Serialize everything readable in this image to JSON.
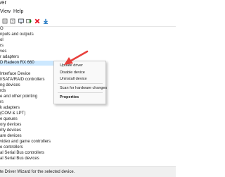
{
  "window": {
    "title_fragment": "ver"
  },
  "menu": {
    "view": "View",
    "help": "Help"
  },
  "toolbar": {
    "icons": [
      "properties-icon",
      "help-icon",
      "monitor-icon",
      "update-driver-icon",
      "uninstall-icon",
      "download-icon"
    ],
    "colors": {
      "uninstall": "#e81123",
      "update": "#107c10",
      "download": "#0f6cbd"
    }
  },
  "tree": {
    "rows": [
      "O",
      "nputs and outputs",
      "ol",
      "rs",
      "ves",
      "r adapters",
      "D Radeon RX 660",
      "",
      "Interface Device",
      "I/SATA/RAID controllers",
      "ng devices",
      "rds",
      "e and other pointing",
      "rs",
      "k adapters",
      "(COM & LPT)",
      "e queues",
      "ory devices",
      "rity devices",
      "are devices",
      "video and game controllers",
      "e controllers",
      "al Serial Bus controllers",
      "al Serial Bus devices",
      "ae Driver Wizard for the selected device."
    ]
  },
  "status": {
    "text": "te Driver Wizard for the selected device."
  },
  "context_menu": {
    "items": {
      "update": "Update driver",
      "disable": "Disable device",
      "uninstall": "Uninstall device",
      "scan": "Scan for hardware changes",
      "properties": "Properties"
    }
  },
  "annotation": {
    "arrow_color": "#e8403c"
  }
}
